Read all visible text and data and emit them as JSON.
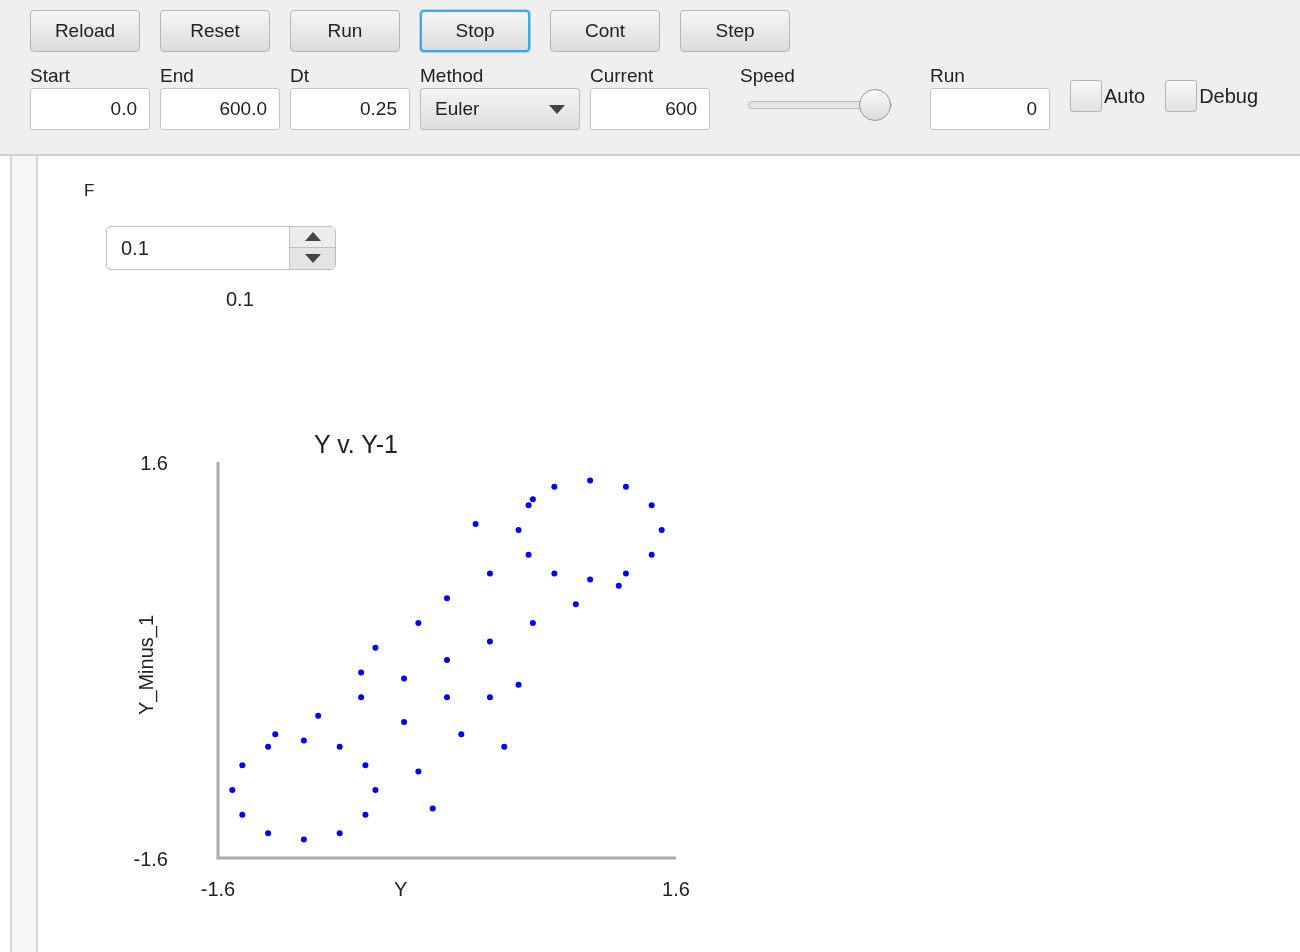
{
  "toolbar": {
    "buttons": [
      {
        "label": "Reload",
        "focused": false
      },
      {
        "label": "Reset",
        "focused": false
      },
      {
        "label": "Run",
        "focused": false
      },
      {
        "label": "Stop",
        "focused": true
      },
      {
        "label": "Cont",
        "focused": false
      },
      {
        "label": "Step",
        "focused": false
      }
    ],
    "fields": [
      {
        "kind": "text",
        "label": "Start",
        "value": "0.0"
      },
      {
        "kind": "text",
        "label": "End",
        "value": "600.0"
      },
      {
        "kind": "text",
        "label": "Dt",
        "value": "0.25"
      },
      {
        "kind": "dropdown",
        "label": "Method",
        "value": "Euler"
      },
      {
        "kind": "text",
        "label": "Current",
        "value": "600"
      },
      {
        "kind": "slider",
        "label": "Speed",
        "level": 1.0
      },
      {
        "kind": "text",
        "label": "Run",
        "value": "0"
      }
    ],
    "checkboxes": [
      {
        "label": "Auto",
        "checked": false
      },
      {
        "label": "Debug",
        "checked": false
      }
    ]
  },
  "parameter": {
    "label": "F",
    "value": "0.1",
    "reading": "0.1"
  },
  "chart": {
    "chart_data": {
      "type": "scatter",
      "title": "Y v. Y-1",
      "xlabel": "Y",
      "ylabel": "Y_Minus_1",
      "xlim": [
        -1.6,
        1.6
      ],
      "ylim": [
        -1.6,
        1.6
      ],
      "xticks": [
        -1.6,
        1.6
      ],
      "yticks": [
        -1.6,
        1.6
      ],
      "x": [
        -0.5,
        -0.57,
        -0.75,
        -1.0,
        -1.25,
        -1.43,
        -1.5,
        -1.43,
        -1.25,
        -1.0,
        -0.75,
        -0.57,
        1.5,
        1.43,
        1.25,
        1.0,
        0.75,
        0.57,
        0.5,
        0.57,
        0.75,
        1.0,
        1.25,
        1.43,
        -1.2,
        -0.9,
        -0.6,
        -0.3,
        0,
        0.3,
        0.6,
        0.9,
        1.2,
        -0.3,
        -0.2,
        0.1,
        0.3,
        0.4,
        -0.5,
        -0.2,
        0,
        0.3,
        0.2,
        0.6,
        0.5,
        -0.6,
        -0.1,
        0.0
      ],
      "series": [
        {
          "color": "#0000ff",
          "values": [
            -1.05,
            -0.85,
            -0.7,
            -0.65,
            -0.7,
            -0.85,
            -1.05,
            -1.25,
            -1.4,
            -1.45,
            -1.4,
            -1.25,
            1.05,
            1.25,
            1.4,
            1.45,
            1.4,
            1.25,
            1.05,
            0.85,
            0.7,
            0.65,
            0.7,
            0.85,
            -0.6,
            -0.45,
            -0.3,
            -0.15,
            0,
            0.15,
            0.3,
            0.45,
            0.6,
            -0.5,
            -0.9,
            -0.6,
            -0.3,
            -0.7,
            0.1,
            0.3,
            0.5,
            0.7,
            1.1,
            1.3,
            -0.2,
            -0.1,
            -1.2,
            -0.3
          ]
        }
      ]
    }
  }
}
